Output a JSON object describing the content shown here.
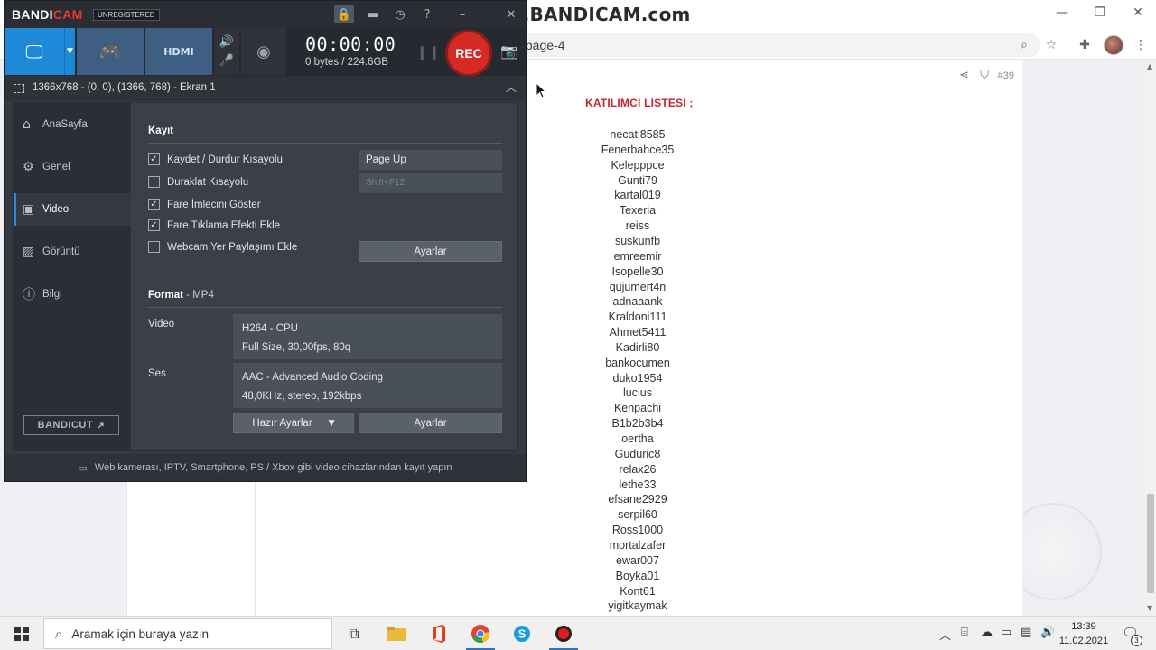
{
  "watermark": "www.BANDICAM.com",
  "browser": {
    "url": "/page-4",
    "post_number": "#39",
    "list_title": "KATILIMCI LİSTESİ ;",
    "participants": [
      "necati8585",
      "Fenerbahce35",
      "Kelepppce",
      "Gunti79",
      "kartal019",
      "Texeria",
      "reiss",
      "suskunfb",
      "emreemir",
      "Isopelle30",
      "qujumert4n",
      "adnaaank",
      "Kraldoni111",
      "Ahmet5411",
      "Kadirli80",
      "bankocumen",
      "duko1954",
      "lucius",
      "Kenpachi",
      "B1b2b3b4",
      "oertha",
      "Guduric8",
      "relax26",
      "lethe33",
      "efsane2929",
      "serpil60",
      "Ross1000",
      "mortalzafer",
      "ewar007",
      "Boyka01",
      "Kont61",
      "yigitkaymak"
    ],
    "icons": {
      "minimize": "minimize-icon",
      "maximize": "restore-icon",
      "close": "close-icon",
      "zoom": "zoom-icon",
      "star": "star-icon",
      "extensions": "puzzle-icon",
      "menu": "kebab-menu-icon"
    }
  },
  "bandicam": {
    "logo_main": "BANDI",
    "logo_accent": "CAM",
    "unregistered": "UNREGISTERED",
    "timer": "00:00:00",
    "bytes": "0 bytes / 224.6GB",
    "rec_label": "REC",
    "region": "1366x768 - (0, 0), (1366, 768) - Ekran 1",
    "nav": [
      {
        "label": "AnaSayfa",
        "icon": "home-icon"
      },
      {
        "label": "Genel",
        "icon": "gear-icon"
      },
      {
        "label": "Video",
        "icon": "video-icon"
      },
      {
        "label": "Görüntü",
        "icon": "image-icon"
      },
      {
        "label": "Bilgi",
        "icon": "info-icon"
      }
    ],
    "active_nav": "Video",
    "bandicut": "BANDICUT",
    "record": {
      "title": "Kayıt",
      "options": [
        {
          "label": "Kaydet / Durdur Kısayolu",
          "checked": true
        },
        {
          "label": "Duraklat Kısayolu",
          "checked": false
        },
        {
          "label": "Fare İmlecini Göster",
          "checked": true
        },
        {
          "label": "Fare Tıklama Efekti Ekle",
          "checked": true
        },
        {
          "label": "Webcam Yer Paylaşımı Ekle",
          "checked": false
        }
      ],
      "hotkey_record": "Page Up",
      "hotkey_pause": "Shift+F12",
      "settings_button": "Ayarlar"
    },
    "format": {
      "title": "Format",
      "container": "MP4",
      "video_label": "Video",
      "video_codec": "H264 - CPU",
      "video_detail": "Full Size, 30,00fps, 80q",
      "audio_label": "Ses",
      "audio_codec": "AAC - Advanced Audio Coding",
      "audio_detail": "48,0KHz, stereo, 192kbps",
      "presets_button": "Hazır Ayarlar",
      "settings_button": "Ayarlar"
    },
    "footer": "Web kamerası, IPTV, Smartphone, PS / Xbox gibi video cihazlarından kayıt yapın"
  },
  "taskbar": {
    "search_placeholder": "Aramak için buraya yazın",
    "time": "13:39",
    "date": "11.02.2021",
    "notification_count": "3",
    "apps": [
      "task-view-icon",
      "file-explorer-icon",
      "office-icon",
      "chrome-icon",
      "skype-icon",
      "bandicam-icon"
    ]
  },
  "colors": {
    "accent": "#1e8ad7",
    "rec": "#d62a27",
    "list_title": "#c0272d"
  }
}
